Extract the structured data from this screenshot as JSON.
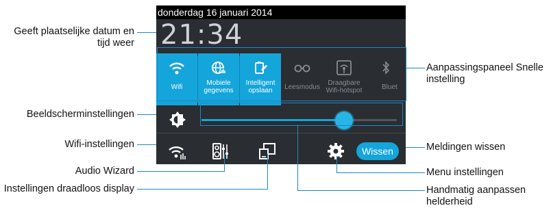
{
  "statusbar": {
    "date": "donderdag 16 januari 2014"
  },
  "clock": "21:34",
  "tiles": [
    {
      "label": "Wifi",
      "state": "on"
    },
    {
      "label": "Mobiele gegevens",
      "state": "on"
    },
    {
      "label": "Intelligent opslaan",
      "state": "on"
    },
    {
      "label": "Leesmodus",
      "state": "off"
    },
    {
      "label": "Draagbare Wifi-hotspot",
      "state": "off"
    },
    {
      "label": "Bluet",
      "state": "off"
    }
  ],
  "brightness": {
    "level_fraction": 0.73
  },
  "buttons": {
    "clear_label": "Wissen"
  },
  "callouts": {
    "datetime": "Geeft plaatselijke datum en tijd weer",
    "quick_settings": "Aanpassingspaneel Snelle instelling",
    "display_settings": "Beeldscherminstellingen",
    "wifi_settings": "Wifi-instellingen",
    "audio_wizard": "Audio Wizard",
    "wireless_display": "Instellingen draadloos display",
    "clear_notifications": "Meldingen wissen",
    "menu_settings": "Menu instellingen",
    "manual_brightness": "Handmatig aanpassen helderheid"
  },
  "colors": {
    "accent": "#14a5da",
    "panel": "#2a2d31",
    "callout_line": "#1e87c8"
  }
}
